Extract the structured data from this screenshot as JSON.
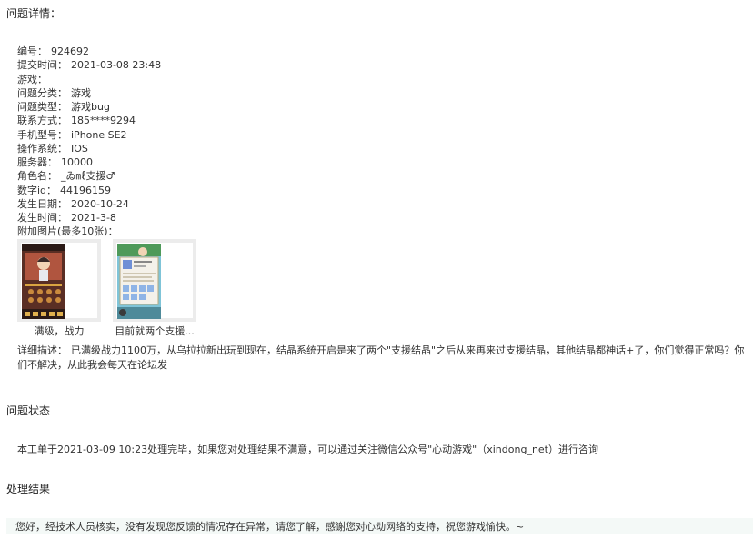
{
  "details": {
    "title": "问题详情：",
    "fields": [
      {
        "label": "编号：",
        "value": "924692"
      },
      {
        "label": "提交时间：",
        "value": "2021-03-08 23:48"
      },
      {
        "label": "游戏：",
        "value": ""
      },
      {
        "label": "问题分类：",
        "value": "游戏"
      },
      {
        "label": "问题类型：",
        "value": "游戏bug"
      },
      {
        "label": "联系方式：",
        "value": "185****9294"
      },
      {
        "label": "手机型号：",
        "value": "iPhone SE2"
      },
      {
        "label": "操作系统：",
        "value": "IOS"
      },
      {
        "label": "服务器：",
        "value": "10000"
      },
      {
        "label": "角色名：",
        "value": "_ゐ㎖支援♂"
      },
      {
        "label": "数字id：",
        "value": "44196159"
      },
      {
        "label": "发生日期：",
        "value": "2020-10-24"
      },
      {
        "label": "发生时间：",
        "value": "2021-3-8"
      }
    ],
    "attachments_label": "附加图片(最多10张)：",
    "attachments": [
      {
        "caption": "满级，战力"
      },
      {
        "caption": "目前就两个支援..."
      }
    ],
    "description_label": "详细描述：",
    "description": "已满级战力1100万，从乌拉拉新出玩到现在，结晶系统开启是来了两个\"支援结晶\"之后从来再来过支援结晶，其他结晶都神话+了，你们觉得正常吗？你们不解决，从此我会每天在论坛发"
  },
  "status": {
    "title": "问题状态",
    "text": "本工单于2021-03-09 10:23处理完毕，如果您对处理结果不满意，可以通过关注微信公众号\"心动游戏\"（xindong_net）进行咨询"
  },
  "result": {
    "title": "处理结果",
    "text": "您好，经技术人员核实，没有发现您反馈的情况存在异常，请您了解，感谢您对心动网络的支持，祝您游戏愉快。~"
  }
}
